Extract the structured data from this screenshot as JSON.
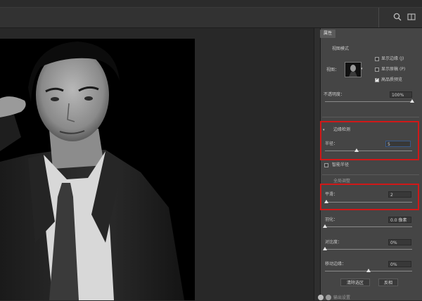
{
  "panel": {
    "tab_label": "属性",
    "view_mode": {
      "heading": "视图模式",
      "view_label": "视图：",
      "show_edge_label": "显示边缘",
      "show_edge_shortcut": "(J)",
      "show_original_label": "显示原稿",
      "show_original_shortcut": "(P)",
      "hq_preview_label": "高品质预览",
      "show_edge_checked": false,
      "show_original_checked": false,
      "hq_preview_checked": true
    },
    "opacity": {
      "label": "不透明度：",
      "value": "100%",
      "level": 1.0
    },
    "edge_detection": {
      "heading": "边缘检测",
      "radius_label": "半径：",
      "radius_value": "5",
      "radius_level": 0.36,
      "smart_radius_label": "智能半径",
      "smart_radius_checked": false
    },
    "global_refine": {
      "heading": "全局调整",
      "smooth_label": "平滑：",
      "smooth_value": "2",
      "smooth_level": 0.02,
      "feather_label": "羽化：",
      "feather_value": "0.0 像素",
      "feather_level": 0.0,
      "contrast_label": "对比度：",
      "contrast_value": "0%",
      "contrast_level": 0.0,
      "shift_edge_label": "移动边缘：",
      "shift_edge_value": "0%",
      "shift_edge_level": 0.5
    },
    "buttons": {
      "clear_selection": "清除选区",
      "invert": "反相"
    },
    "bottom_label": "输出设置"
  },
  "colors": {
    "highlight": "#d01818",
    "panel_bg": "#454545",
    "canvas_bg": "#282828"
  }
}
